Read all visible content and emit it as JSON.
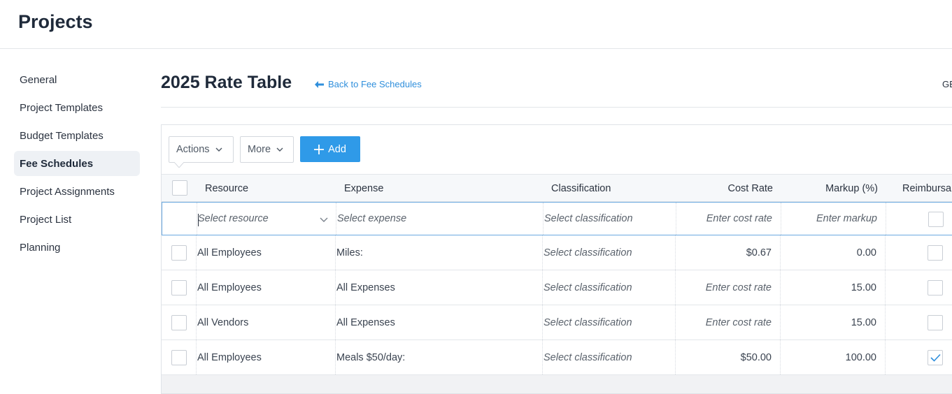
{
  "app": {
    "title": "Projects"
  },
  "sidebar": {
    "items": [
      {
        "label": "General",
        "active": false
      },
      {
        "label": "Project Templates",
        "active": false
      },
      {
        "label": "Budget Templates",
        "active": false
      },
      {
        "label": "Fee Schedules",
        "active": true
      },
      {
        "label": "Project Assignments",
        "active": false
      },
      {
        "label": "Project List",
        "active": false
      },
      {
        "label": "Planning",
        "active": false
      }
    ]
  },
  "page": {
    "title": "2025 Rate Table",
    "back_link": "Back to Fee Schedules",
    "right_text": "GBP"
  },
  "toolbar": {
    "actions_label": "Actions",
    "more_label": "More",
    "add_label": "Add"
  },
  "table": {
    "columns": [
      "Resource",
      "Expense",
      "Classification",
      "Cost Rate",
      "Markup (%)",
      "Reimbursable"
    ],
    "edit_row": {
      "resource_placeholder": "Select resource",
      "expense_placeholder": "Select expense",
      "classification_placeholder": "Select classification",
      "cost_rate_placeholder": "Enter cost rate",
      "markup_placeholder": "Enter markup",
      "reimbursable": false
    },
    "rows": [
      {
        "resource": "All Employees",
        "expense": "Miles:",
        "classification": "Select classification",
        "cost_rate": "$0.67",
        "markup": "0.00",
        "reimbursable": false
      },
      {
        "resource": "All Employees",
        "expense": "All Expenses",
        "classification": "Select classification",
        "cost_rate": "Enter cost rate",
        "markup": "15.00",
        "reimbursable": false
      },
      {
        "resource": "All Vendors",
        "expense": "All Expenses",
        "classification": "Select classification",
        "cost_rate": "Enter cost rate",
        "markup": "15.00",
        "reimbursable": false
      },
      {
        "resource": "All Employees",
        "expense": "Meals $50/day:",
        "classification": "Select classification",
        "cost_rate": "$50.00",
        "markup": "100.00",
        "reimbursable": true
      }
    ]
  },
  "colors": {
    "accent": "#2f9ae8",
    "link": "#2f8fdc",
    "active_bg": "#eef1f5"
  },
  "icons": [
    "arrow-left-icon",
    "chevron-down-icon",
    "plus-icon",
    "checkmark-icon"
  ]
}
